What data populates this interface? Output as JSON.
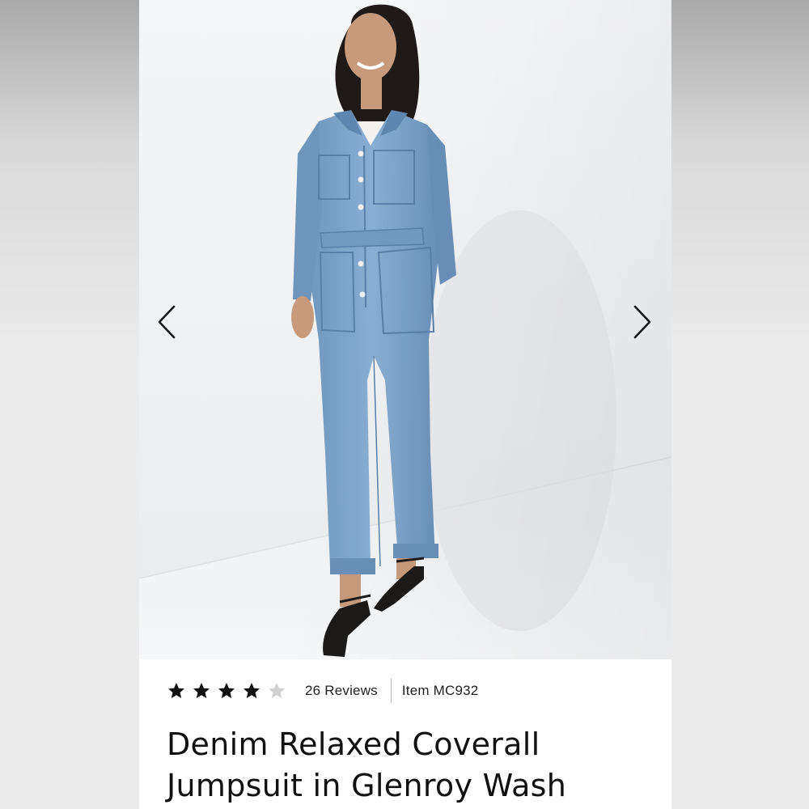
{
  "product": {
    "rating": 4,
    "rating_max": 5,
    "reviews_label": "26 Reviews",
    "item_label": "Item MC932",
    "title": "Denim Relaxed Coverall Jumpsuit in Glenroy Wash"
  },
  "gallery": {
    "prev_icon": "chevron-left-icon",
    "next_icon": "chevron-right-icon"
  },
  "colors": {
    "star_filled": "#111111",
    "star_empty": "#d0d0d0",
    "denim": "#7ea3c8",
    "text": "#111111"
  }
}
